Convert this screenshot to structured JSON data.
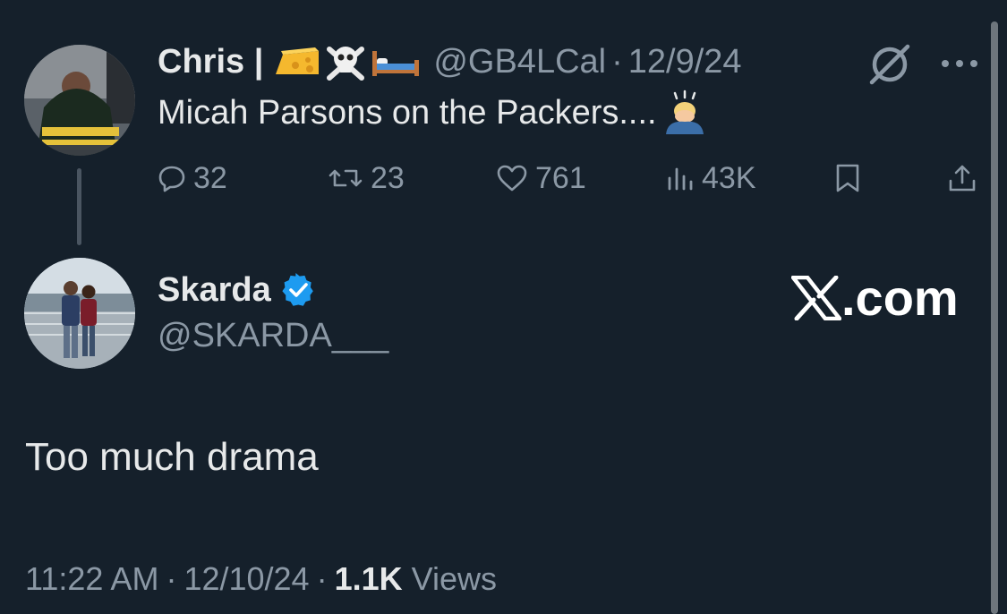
{
  "parent_tweet": {
    "display_name": "Chris |",
    "name_emojis": [
      "cheese-emoji",
      "skull-crossbones-emoji",
      "bed-emoji"
    ],
    "handle": "@GB4LCal",
    "separator": "·",
    "date": "12/9/24",
    "text": "Micah Parsons on the Packers....",
    "text_emoji": "person-bowing-emoji",
    "actions": {
      "replies": "32",
      "reposts": "23",
      "likes": "761",
      "views": "43K"
    }
  },
  "reply_tweet": {
    "display_name": "Skarda",
    "verified": true,
    "handle": "@SKARDA___",
    "text": "Too much drama",
    "time": "11:22 AM",
    "separator": "·",
    "date": "12/10/24",
    "views_count": "1.1K",
    "views_label": "Views"
  },
  "watermark": {
    "text": ".com",
    "logo": "x-logo"
  },
  "colors": {
    "background": "#15202b",
    "primary_text": "#e7e9ea",
    "secondary_text": "#8b98a5",
    "verified_blue": "#1d9bf0"
  }
}
